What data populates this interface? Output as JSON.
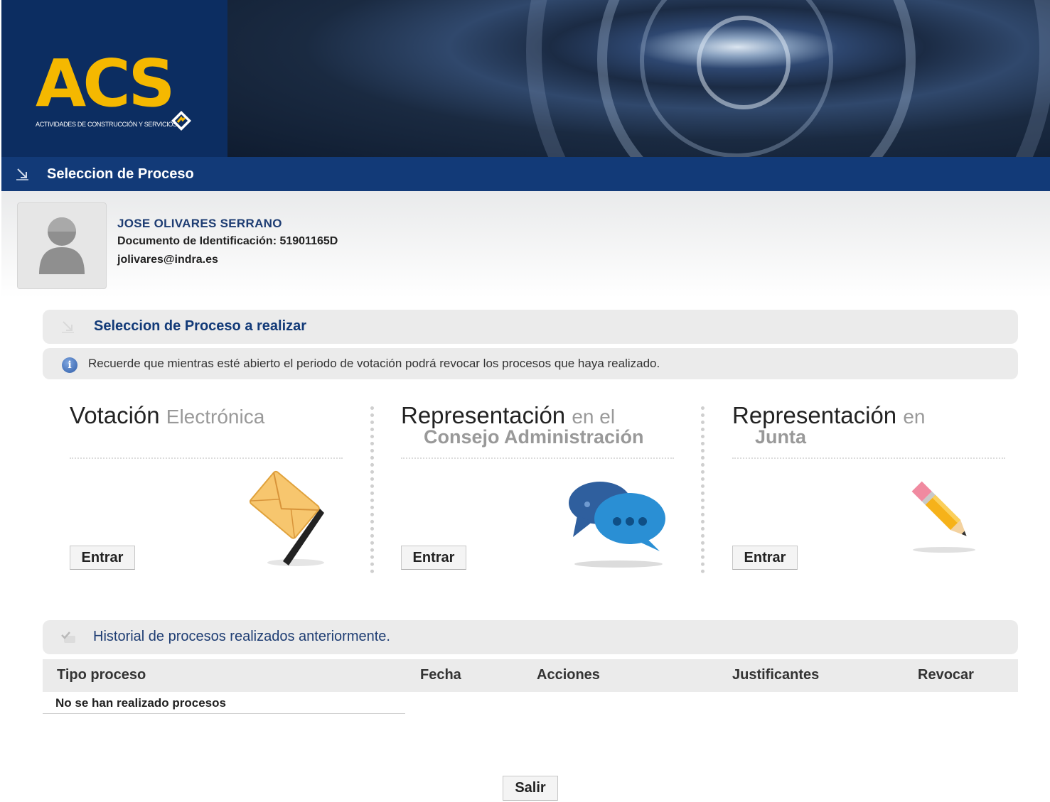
{
  "header": {
    "logo_text": "ACS",
    "logo_subtitle": "ACTIVIDADES DE CONSTRUCCIÓN Y SERVICIOS",
    "nav_title": "Seleccion de Proceso"
  },
  "user": {
    "name": "JOSE OLIVARES SERRANO",
    "document": "Documento de Identificación: 51901165D",
    "email": "jolivares@indra.es"
  },
  "process_section": {
    "title": "Seleccion de Proceso a realizar",
    "info_text": "Recuerde que mientras esté abierto el periodo de votación podrá revocar los procesos que haya realizado."
  },
  "options": [
    {
      "title_main": "Votación",
      "title_light": "Electrónica",
      "subtitle": "",
      "button": "Entrar",
      "icon": "envelope-icon"
    },
    {
      "title_main": "Representación",
      "title_light": "en el",
      "subtitle": "Consejo Administración",
      "button": "Entrar",
      "icon": "chat-bubbles-icon"
    },
    {
      "title_main": "Representación",
      "title_light": "en",
      "subtitle": "Junta",
      "button": "Entrar",
      "icon": "pencil-icon"
    }
  ],
  "history": {
    "title": "Historial de procesos realizados anteriormente.",
    "columns": [
      "Tipo proceso",
      "Fecha",
      "Acciones",
      "Justificantes",
      "Revocar"
    ],
    "empty_text": "No se han realizado procesos"
  },
  "footer": {
    "exit_button": "Salir"
  },
  "colors": {
    "brand_navy": "#123a78",
    "logo_yellow": "#f5b800",
    "panel_gray": "#ebebeb"
  }
}
